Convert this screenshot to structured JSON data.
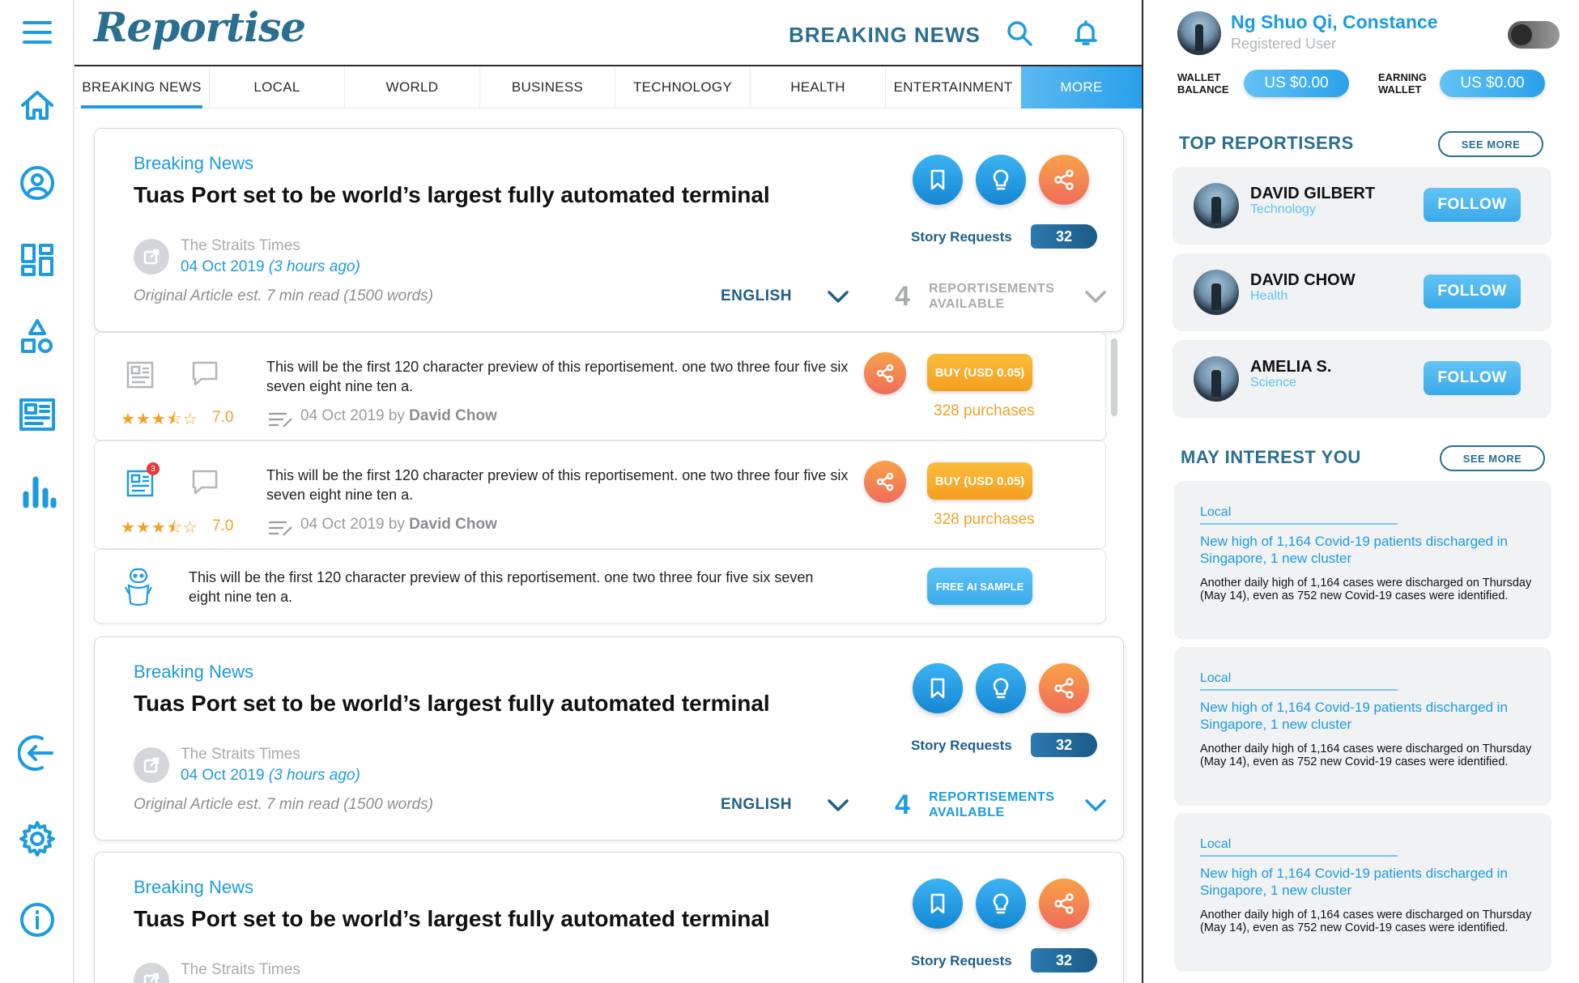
{
  "app": {
    "logo": "Reportise",
    "section_title": "BREAKING NEWS"
  },
  "icons": [
    "menu-icon",
    "home-icon",
    "profile-icon",
    "dashboard-icon",
    "shapes-icon",
    "articles-icon",
    "chart-icon",
    "logout-icon",
    "settings-icon",
    "info-icon",
    "search-icon",
    "bell-icon"
  ],
  "tabs": [
    {
      "label": "BREAKING NEWS",
      "active": true
    },
    {
      "label": "LOCAL"
    },
    {
      "label": "WORLD"
    },
    {
      "label": "BUSINESS"
    },
    {
      "label": "TECHNOLOGY"
    },
    {
      "label": "HEALTH"
    },
    {
      "label": "ENTERTAINMENT"
    },
    {
      "label": "MORE"
    }
  ],
  "articles": [
    {
      "category": "Breaking News",
      "title": "Tuas Port set to be world’s largest fully automated terminal",
      "source": "The Straits Times",
      "date": "04 Oct 2019",
      "ago": "(3 hours ago)",
      "original": "Original Article",
      "read_info": "est. 7 min read (1500 words)",
      "language": "ENGLISH",
      "reportisements_count": "4",
      "reportisements_label_1": "REPORTISEMENTS",
      "reportisements_label_2": "AVAILABLE",
      "story_requests_label": "Story Requests",
      "story_requests": "32"
    },
    {
      "category": "Breaking News",
      "title": "Tuas Port set to be world’s largest fully automated terminal",
      "source": "The Straits Times",
      "date": "04 Oct 2019",
      "ago": "(3 hours ago)",
      "original": "Original Article",
      "read_info": "est. 7 min read (1500 words)",
      "language": "ENGLISH",
      "reportisements_count": "4",
      "reportisements_label_1": "REPORTISEMENTS",
      "reportisements_label_2": "AVAILABLE",
      "story_requests_label": "Story Requests",
      "story_requests": "32"
    },
    {
      "category": "Breaking News",
      "title": "Tuas Port set to be world’s largest fully automated terminal",
      "source": "The Straits Times",
      "story_requests_label": "Story Requests",
      "story_requests": "32"
    }
  ],
  "reportisements": [
    {
      "preview": "This will be the first 120 character preview of this reportisement. one two three four five six seven eight nine ten a.",
      "stars": "★★★⯪☆",
      "rating": "7.0",
      "date": "04 Oct 2019 by",
      "author": "David Chow",
      "buy_label": "BUY (USD 0.05)",
      "purchases": "328 purchases"
    },
    {
      "preview": "This will be the first 120 character preview of this reportisement. one two three four five six seven eight nine ten a.",
      "stars": "★★★⯪☆",
      "rating": "7.0",
      "date": "04 Oct 2019 by",
      "author": "David Chow",
      "buy_label": "BUY (USD 0.05)",
      "purchases": "328 purchases",
      "badge": "3"
    },
    {
      "preview": "This will be the first 120 character preview of this reportisement. one two three four five six seven eight nine ten a.",
      "free_label": "FREE AI SAMPLE"
    }
  ],
  "user": {
    "name": "Ng Shuo Qi, Constance",
    "role": "Registered User",
    "wallet_label_1": "WALLET",
    "wallet_label_2": "BALANCE",
    "wallet_value": "US $0.00",
    "earning_label_1": "EARNING",
    "earning_label_2": "WALLET",
    "earning_value": "US $0.00"
  },
  "top_reportisers": {
    "title": "TOP REPORTISERS",
    "see_more": "SEE MORE",
    "items": [
      {
        "name": "DAVID GILBERT",
        "category": "Technology",
        "follow": "FOLLOW"
      },
      {
        "name": "DAVID CHOW",
        "category": "Health",
        "follow": "FOLLOW"
      },
      {
        "name": "AMELIA S.",
        "category": "Science",
        "follow": "FOLLOW"
      }
    ]
  },
  "may_interest": {
    "title": "MAY INTEREST YOU",
    "see_more": "SEE MORE",
    "items": [
      {
        "tag": "Local",
        "headline": "New high of 1,164 Covid-19 patients discharged in Singapore, 1 new cluster",
        "body": "Another daily high of 1,164 cases were discharged on Thursday (May 14), even as 752 new Covid-19 cases were identified."
      },
      {
        "tag": "Local",
        "headline": "New high of 1,164 Covid-19 patients discharged in Singapore, 1 new cluster",
        "body": "Another daily high of 1,164 cases were discharged on Thursday (May 14), even as 752 new Covid-19 cases were identified."
      },
      {
        "tag": "Local",
        "headline": "New high of 1,164 Covid-19 patients discharged in Singapore, 1 new cluster",
        "body": "Another daily high of 1,164 cases were discharged on Thursday (May 14), even as 752 new Covid-19 cases were identified."
      }
    ]
  },
  "colors": {
    "accent": "#1d9be0",
    "brand": "#2a6f8f",
    "orange": "#f59f1f"
  }
}
